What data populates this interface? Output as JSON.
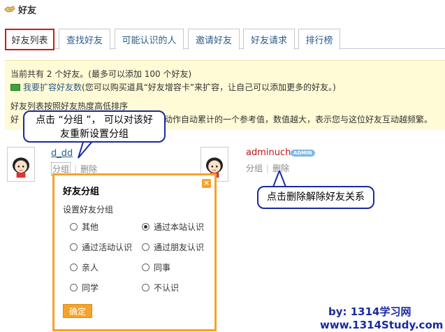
{
  "header": {
    "title": "好友",
    "icon": "handshake-icon"
  },
  "tabs": [
    {
      "label": "好友列表",
      "active": true
    },
    {
      "label": "查找好友"
    },
    {
      "label": "可能认识的人"
    },
    {
      "label": "邀请好友"
    },
    {
      "label": "好友请求"
    },
    {
      "label": "排行榜"
    }
  ],
  "info": {
    "line1": "当前共有 2 个好友。(最多可以添加 100 个好友)",
    "expand_link": "我要扩容好友数",
    "expand_desc": "(您可以购买道具“好友增容卡”来扩容，让自己可以添加更多的好友。)",
    "line3": "好友列表按照好友热度高低排序",
    "line4a": "好",
    "line4b": "动作自动累计的一个参考值，数值越大，表示您与这位好友互动越频繁。"
  },
  "friends": [
    {
      "name": "d_dd",
      "group": "分组",
      "delete": "删除"
    },
    {
      "name": "adminuch",
      "badge": "ADMIN",
      "group": "分组",
      "delete": "删除"
    }
  ],
  "callouts": {
    "group_hint": "点击 “分组 ”， 可以对该好友重新设置分组",
    "group_hint_line1": "点击 “分组 ”， 可以对该好",
    "group_hint_line2": "友重新设置分组",
    "delete_hint": "点击删除解除好友关系"
  },
  "popup": {
    "title": "好友分组",
    "subtitle": "设置好友分组",
    "options": [
      {
        "label": "其他",
        "checked": false
      },
      {
        "label": "通过本站认识",
        "checked": true
      },
      {
        "label": "通过活动认识",
        "checked": false
      },
      {
        "label": "通过朋友认识",
        "checked": false
      },
      {
        "label": "亲人",
        "checked": false
      },
      {
        "label": "同事",
        "checked": false
      },
      {
        "label": "同学",
        "checked": false
      },
      {
        "label": "不认识",
        "checked": false
      }
    ],
    "confirm": "确定",
    "close": "×"
  },
  "watermark": {
    "line1": "by: 1314学习网",
    "line2": "www.1314Study.com"
  },
  "colors": {
    "accent": "#f5a32a",
    "link": "#2b5d8a",
    "active_tab_border": "#d01818",
    "callout_border": "#1a2aa0",
    "info_bg": "#fffbd6"
  }
}
